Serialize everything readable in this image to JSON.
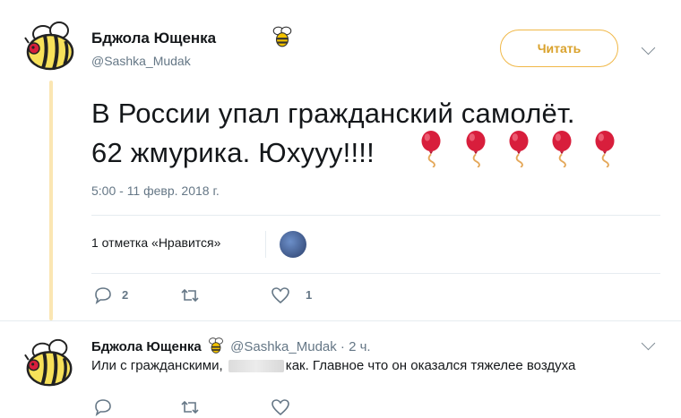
{
  "tweet": {
    "author_name": "Бджола Ющенка",
    "author_handle": "@Sashka_Mudak",
    "follow_label": "Читать",
    "text_line1": "В России упал гражданский самолёт.",
    "text_line2": "62 жмурика. Юхууу!!!!",
    "timestamp": "5:00 - 11 февр. 2018 г.",
    "likes_summary": "1 отметка «Нравится»",
    "actions": {
      "reply_count": "2",
      "retweet_count": "",
      "like_count": "1"
    },
    "icons": [
      "bee-icon",
      "balloon-icon",
      "chevron-down-icon",
      "reply-icon",
      "retweet-icon",
      "heart-icon"
    ]
  },
  "reply": {
    "author_name": "Бджола Ющенка",
    "author_handle": "@Sashka_Mudak",
    "time_ago": "· 2 ч.",
    "text_before": "Или с гражданскими,",
    "text_after": "как. Главное что он оказался тяжелее воздуха"
  },
  "colors": {
    "accent": "#f0b848",
    "balloon": "#d81e3c",
    "muted": "#657786"
  }
}
